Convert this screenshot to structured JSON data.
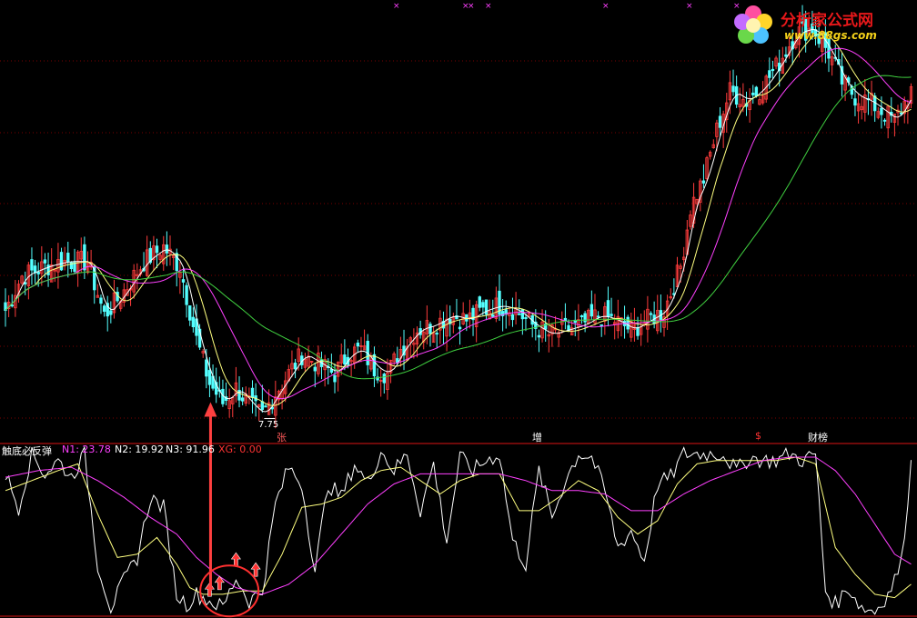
{
  "logo": {
    "title": "分析家公式网",
    "url": "www.88gs.com",
    "title_color": "#e8181a",
    "url_color": "#f5d21a"
  },
  "indicator": {
    "name": "触底必反弹",
    "n1_label": "N1: 23.78",
    "n2_label": "N2: 19.92",
    "n3_label": "N3: 91.96",
    "xg_label": "XG: 0.00"
  },
  "annotations": {
    "low_price": "7.75",
    "events": [
      "张",
      "增",
      "$",
      "财榜"
    ]
  },
  "colors": {
    "up": "#ff3c3c",
    "down": "#54ffff",
    "ma_fast": "#ffffff",
    "ma_mid": "#ffff80",
    "ma_slow": "#ff40ff",
    "ma_long": "#40d040",
    "grid": "#7a0000",
    "signal": "#ff3333",
    "n1": "#ffffff",
    "n2": "#ffff80",
    "n3": "#ff40ff",
    "xg": "#ff3333"
  },
  "chart_data": [
    {
      "type": "candlestick",
      "title": "",
      "ylim": [
        7.2,
        16.2
      ],
      "series_names": [
        "close",
        "MA5",
        "MA10",
        "MA20",
        "MA60"
      ],
      "close_keypoints": [
        [
          0,
          9.9
        ],
        [
          5,
          10.6
        ],
        [
          12,
          10.8
        ],
        [
          18,
          10.9
        ],
        [
          25,
          10.9
        ],
        [
          30,
          9.8
        ],
        [
          35,
          10.2
        ],
        [
          42,
          10.9
        ],
        [
          48,
          11.2
        ],
        [
          53,
          10.8
        ],
        [
          58,
          9.3
        ],
        [
          62,
          8.4
        ],
        [
          66,
          8.0
        ],
        [
          70,
          8.3
        ],
        [
          75,
          7.9
        ],
        [
          78,
          7.75
        ],
        [
          82,
          8.2
        ],
        [
          86,
          8.6
        ],
        [
          90,
          9.0
        ],
        [
          95,
          8.8
        ],
        [
          100,
          8.6
        ],
        [
          104,
          9.0
        ],
        [
          108,
          9.1
        ],
        [
          112,
          8.7
        ],
        [
          116,
          8.6
        ],
        [
          120,
          9.1
        ],
        [
          125,
          9.5
        ],
        [
          130,
          9.6
        ],
        [
          135,
          9.8
        ],
        [
          140,
          9.7
        ],
        [
          145,
          9.9
        ],
        [
          150,
          10.0
        ],
        [
          155,
          9.9
        ],
        [
          160,
          9.6
        ],
        [
          165,
          9.4
        ],
        [
          170,
          9.5
        ],
        [
          175,
          9.6
        ],
        [
          180,
          9.8
        ],
        [
          185,
          9.7
        ],
        [
          190,
          9.5
        ],
        [
          195,
          9.7
        ],
        [
          200,
          9.9
        ],
        [
          205,
          10.8
        ],
        [
          208,
          12.0
        ],
        [
          212,
          12.6
        ],
        [
          216,
          13.6
        ],
        [
          220,
          14.4
        ],
        [
          225,
          14.2
        ],
        [
          230,
          14.5
        ],
        [
          235,
          15.0
        ],
        [
          240,
          15.6
        ],
        [
          245,
          15.7
        ],
        [
          250,
          15.2
        ],
        [
          254,
          14.6
        ],
        [
          258,
          14.3
        ],
        [
          262,
          14.2
        ],
        [
          266,
          14.0
        ],
        [
          270,
          13.8
        ],
        [
          275,
          14.4
        ]
      ],
      "ma_lags": {
        "MA5": 4,
        "MA10": 10,
        "MA20": 22,
        "MA60": 50
      },
      "low_marker": {
        "index": 78,
        "price": 7.75
      }
    },
    {
      "type": "line",
      "title": "触底必反弹",
      "ylim": [
        0,
        100
      ],
      "series": [
        {
          "name": "N1",
          "keypoints": [
            [
              0,
              84
            ],
            [
              4,
              64
            ],
            [
              8,
              96
            ],
            [
              12,
              84
            ],
            [
              16,
              92
            ],
            [
              20,
              82
            ],
            [
              24,
              96
            ],
            [
              28,
              30
            ],
            [
              32,
              4
            ],
            [
              36,
              20
            ],
            [
              40,
              34
            ],
            [
              44,
              70
            ],
            [
              48,
              64
            ],
            [
              52,
              12
            ],
            [
              55,
              6
            ],
            [
              58,
              12
            ],
            [
              62,
              8
            ],
            [
              66,
              4
            ],
            [
              70,
              22
            ],
            [
              74,
              8
            ],
            [
              78,
              14
            ],
            [
              82,
              66
            ],
            [
              86,
              88
            ],
            [
              90,
              78
            ],
            [
              94,
              26
            ],
            [
              98,
              78
            ],
            [
              102,
              70
            ],
            [
              106,
              90
            ],
            [
              110,
              78
            ],
            [
              114,
              98
            ],
            [
              118,
              86
            ],
            [
              122,
              96
            ],
            [
              126,
              62
            ],
            [
              130,
              90
            ],
            [
              134,
              44
            ],
            [
              138,
              94
            ],
            [
              142,
              86
            ],
            [
              146,
              92
            ],
            [
              150,
              96
            ],
            [
              154,
              44
            ],
            [
              158,
              30
            ],
            [
              162,
              86
            ],
            [
              166,
              58
            ],
            [
              170,
              80
            ],
            [
              174,
              96
            ],
            [
              178,
              94
            ],
            [
              182,
              74
            ],
            [
              186,
              40
            ],
            [
              190,
              50
            ],
            [
              194,
              32
            ],
            [
              198,
              78
            ],
            [
              202,
              82
            ],
            [
              206,
              96
            ],
            [
              210,
              96
            ],
            [
              214,
              96
            ],
            [
              218,
              96
            ],
            [
              222,
              86
            ],
            [
              226,
              94
            ],
            [
              230,
              92
            ],
            [
              234,
              92
            ],
            [
              238,
              96
            ],
            [
              242,
              92
            ],
            [
              246,
              96
            ],
            [
              249,
              14
            ],
            [
              252,
              6
            ],
            [
              256,
              16
            ],
            [
              260,
              4
            ],
            [
              264,
              2
            ],
            [
              268,
              12
            ],
            [
              272,
              30
            ],
            [
              275,
              90
            ]
          ]
        },
        {
          "name": "N2",
          "keypoints": [
            [
              0,
              74
            ],
            [
              8,
              80
            ],
            [
              16,
              86
            ],
            [
              22,
              90
            ],
            [
              28,
              60
            ],
            [
              34,
              34
            ],
            [
              40,
              36
            ],
            [
              46,
              46
            ],
            [
              52,
              30
            ],
            [
              56,
              16
            ],
            [
              60,
              12
            ],
            [
              66,
              12
            ],
            [
              72,
              14
            ],
            [
              78,
              14
            ],
            [
              84,
              36
            ],
            [
              90,
              64
            ],
            [
              96,
              66
            ],
            [
              102,
              70
            ],
            [
              108,
              80
            ],
            [
              114,
              86
            ],
            [
              120,
              88
            ],
            [
              126,
              80
            ],
            [
              132,
              72
            ],
            [
              138,
              80
            ],
            [
              144,
              84
            ],
            [
              150,
              84
            ],
            [
              156,
              62
            ],
            [
              162,
              62
            ],
            [
              168,
              70
            ],
            [
              174,
              80
            ],
            [
              180,
              74
            ],
            [
              186,
              58
            ],
            [
              192,
              48
            ],
            [
              198,
              56
            ],
            [
              204,
              78
            ],
            [
              210,
              90
            ],
            [
              216,
              92
            ],
            [
              222,
              92
            ],
            [
              228,
              92
            ],
            [
              234,
              92
            ],
            [
              240,
              94
            ],
            [
              246,
              90
            ],
            [
              252,
              40
            ],
            [
              258,
              24
            ],
            [
              264,
              12
            ],
            [
              270,
              10
            ],
            [
              275,
              18
            ]
          ]
        },
        {
          "name": "N3",
          "keypoints": [
            [
              0,
              82
            ],
            [
              10,
              86
            ],
            [
              20,
              88
            ],
            [
              28,
              80
            ],
            [
              36,
              70
            ],
            [
              44,
              58
            ],
            [
              52,
              48
            ],
            [
              58,
              34
            ],
            [
              64,
              24
            ],
            [
              70,
              16
            ],
            [
              78,
              12
            ],
            [
              86,
              18
            ],
            [
              94,
              30
            ],
            [
              102,
              48
            ],
            [
              110,
              66
            ],
            [
              118,
              78
            ],
            [
              126,
              84
            ],
            [
              134,
              84
            ],
            [
              142,
              84
            ],
            [
              150,
              84
            ],
            [
              158,
              80
            ],
            [
              166,
              74
            ],
            [
              174,
              74
            ],
            [
              182,
              72
            ],
            [
              190,
              62
            ],
            [
              198,
              62
            ],
            [
              206,
              72
            ],
            [
              214,
              80
            ],
            [
              222,
              86
            ],
            [
              230,
              92
            ],
            [
              238,
              94
            ],
            [
              246,
              94
            ],
            [
              252,
              86
            ],
            [
              258,
              72
            ],
            [
              264,
              54
            ],
            [
              270,
              36
            ],
            [
              275,
              30
            ]
          ]
        }
      ],
      "signals": [
        [
          62,
          14
        ],
        [
          65,
          18
        ],
        [
          70,
          32
        ],
        [
          76,
          26
        ]
      ]
    }
  ]
}
